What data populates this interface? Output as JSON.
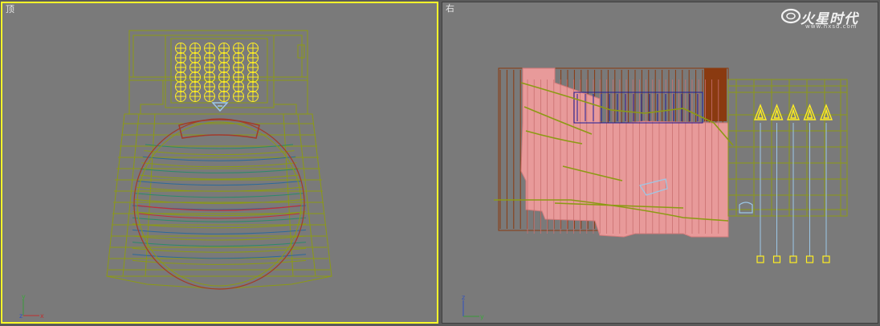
{
  "viewports": {
    "top": {
      "label": "顶",
      "active": true
    },
    "right": {
      "label": "右",
      "active": false
    }
  },
  "watermark": {
    "brand": "火星时代",
    "url": "www.hxsd.com"
  },
  "axis_labels": {
    "top_y": "y",
    "top_z": "z",
    "top_x": "x",
    "right_z": "z",
    "right_y": "y"
  },
  "colors": {
    "active_border": "#ffff2a",
    "viewport_bg": "#7a7a7a",
    "wire_olive": "#8c9a14",
    "wire_pink": "#e89a9a",
    "wire_brown": "#8a3a10",
    "wire_blue": "#1c1c9a",
    "light_yellow": "#ffee22",
    "light_cyan": "#9cc8e8"
  },
  "icons": [
    "axis-tripod-icon",
    "free-light-icon",
    "camera-icon",
    "spotlight-icon",
    "hxsd-logo-icon"
  ]
}
